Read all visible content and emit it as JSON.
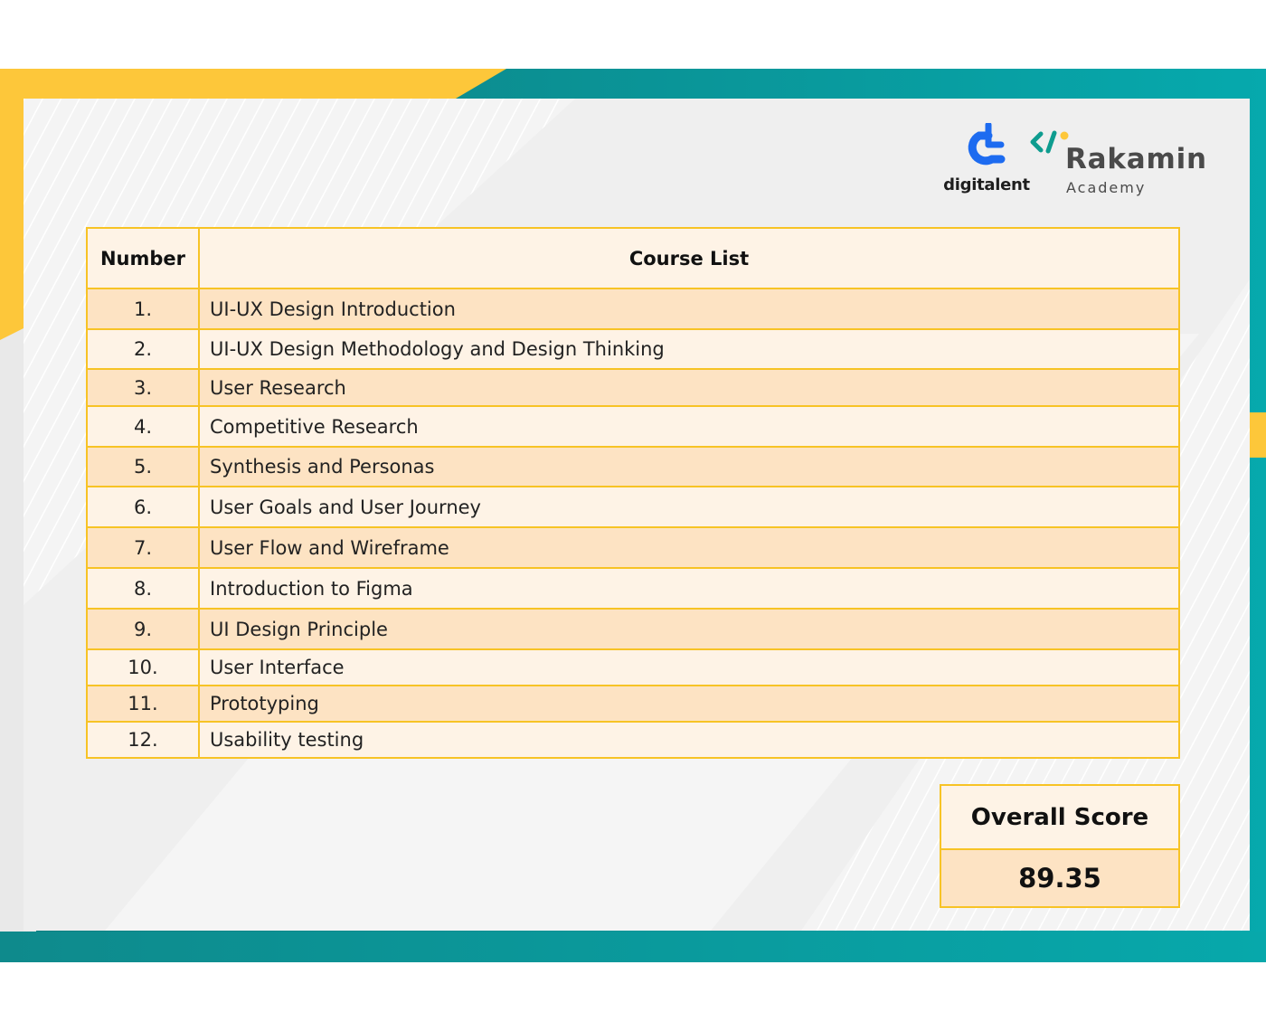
{
  "logos": {
    "digitalent": "digitalent",
    "rakamin_name": "Rakamin",
    "rakamin_sub": "Academy"
  },
  "table": {
    "header_number": "Number",
    "header_course": "Course List",
    "rows": [
      {
        "no": "1.",
        "course": "UI-UX Design Introduction"
      },
      {
        "no": "2.",
        "course": "UI-UX Design Methodology and Design Thinking"
      },
      {
        "no": "3.",
        "course": "User Research"
      },
      {
        "no": "4.",
        "course": "Competitive Research"
      },
      {
        "no": "5.",
        "course": "Synthesis and Personas"
      },
      {
        "no": "6.",
        "course": "User Goals and User Journey"
      },
      {
        "no": "7.",
        "course": "User Flow and Wireframe"
      },
      {
        "no": "8.",
        "course": "Introduction to Figma"
      },
      {
        "no": "9.",
        "course": "UI Design Principle"
      },
      {
        "no": "10.",
        "course": "User Interface"
      },
      {
        "no": "11.",
        "course": "Prototyping"
      },
      {
        "no": "12.",
        "course": "Usability testing"
      }
    ]
  },
  "score": {
    "label": "Overall Score",
    "value": "89.35"
  },
  "colors": {
    "yellow": "#fdc73a",
    "teal": "#0a9a9c",
    "table_border": "#f7c325",
    "row_light": "#fef3e6",
    "row_dark": "#fde3c3",
    "digitalent_blue": "#1d6bf0",
    "rakamin_teal": "#0e9c8f"
  }
}
